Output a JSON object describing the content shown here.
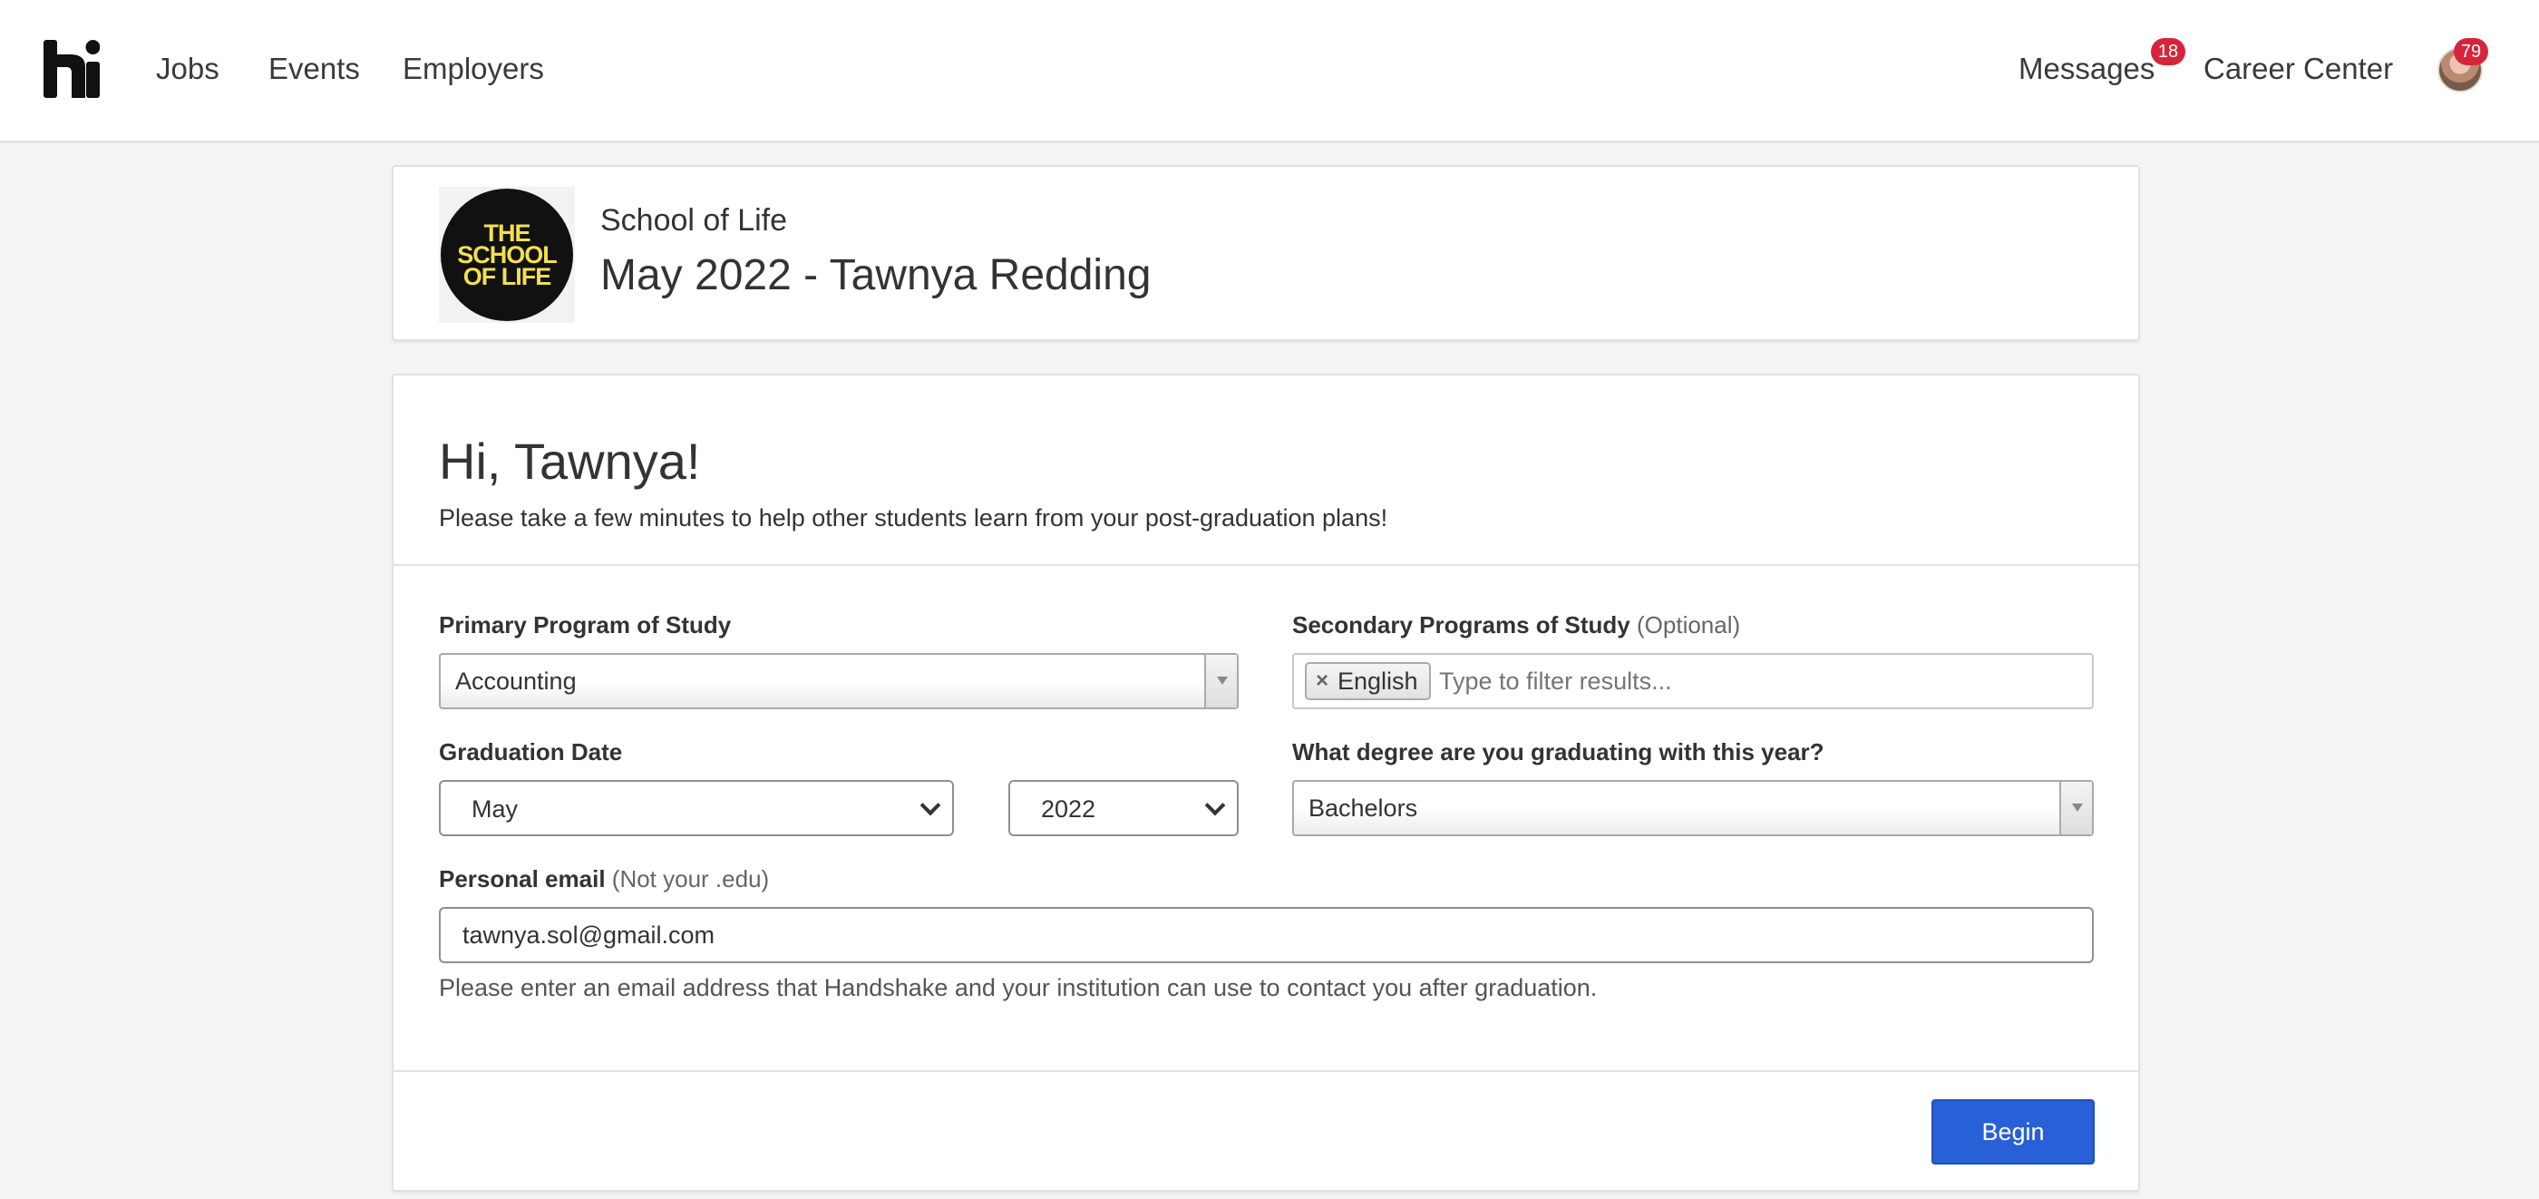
{
  "nav": {
    "links": [
      "Jobs",
      "Events",
      "Employers"
    ],
    "messages_label": "Messages",
    "messages_badge": "18",
    "career_center_label": "Career Center",
    "avatar_badge": "79"
  },
  "survey_header": {
    "school_logo_lines": [
      "THE",
      "SCHOOL",
      "OF LIFE"
    ],
    "school_name": "School of Life",
    "title": "May 2022 - Tawnya Redding"
  },
  "intro": {
    "greeting": "Hi, Tawnya!",
    "text": "Please take a few minutes to help other students learn from your post-graduation plans!"
  },
  "form": {
    "primary_program": {
      "label": "Primary Program of Study",
      "value": "Accounting"
    },
    "secondary_programs": {
      "label": "Secondary Programs of Study",
      "optional_note": "(Optional)",
      "tags": [
        "English"
      ],
      "placeholder": "Type to filter results..."
    },
    "graduation_date": {
      "label": "Graduation Date",
      "month": "May",
      "year": "2022"
    },
    "degree": {
      "label": "What degree are you graduating with this year?",
      "value": "Bachelors"
    },
    "personal_email": {
      "label": "Personal email",
      "note": "(Not your .edu)",
      "value": "tawnya.sol@gmail.com",
      "help": "Please enter an email address that Handshake and your institution can use to contact you after graduation."
    }
  },
  "actions": {
    "begin_label": "Begin"
  },
  "colors": {
    "accent": "#2860d7",
    "badge": "#d6253a",
    "logo_yellow": "#f3e04e"
  }
}
